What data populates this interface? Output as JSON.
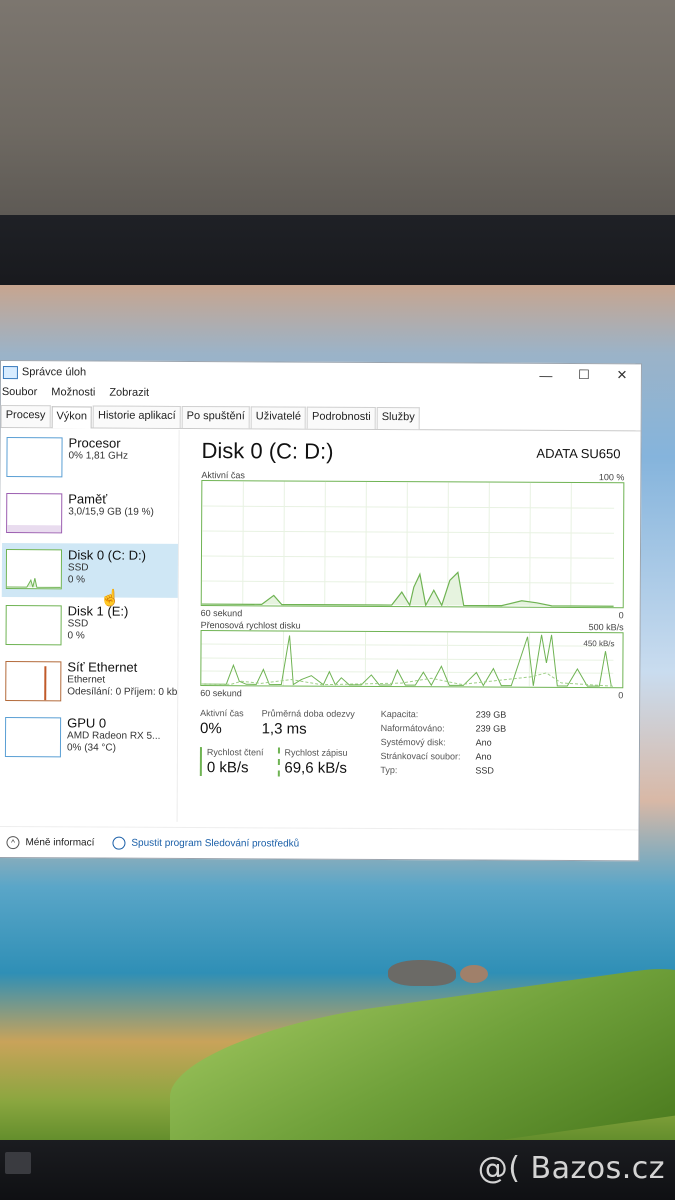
{
  "window": {
    "title": "Správce úloh",
    "minimize": "—",
    "maximize": "☐",
    "close": "✕"
  },
  "menu": [
    "Soubor",
    "Možnosti",
    "Zobrazit"
  ],
  "tabs": [
    "Procesy",
    "Výkon",
    "Historie aplikací",
    "Po spuštění",
    "Uživatelé",
    "Podrobnosti",
    "Služby"
  ],
  "active_tab": "Výkon",
  "resources": [
    {
      "name": "Procesor",
      "line1": "0% 1,81 GHz",
      "line2": "",
      "kind": "cpu"
    },
    {
      "name": "Paměť",
      "line1": "3,0/15,9 GB (19 %)",
      "line2": "",
      "kind": "mem"
    },
    {
      "name": "Disk 0 (C: D:)",
      "line1": "SSD",
      "line2": "0 %",
      "kind": "disk",
      "selected": true
    },
    {
      "name": "Disk 1 (E:)",
      "line1": "SSD",
      "line2": "0 %",
      "kind": "disk"
    },
    {
      "name": "Síť Ethernet",
      "line1": "Ethernet",
      "line2": "Odesílání: 0 Příjem: 0 kb",
      "kind": "net"
    },
    {
      "name": "GPU 0",
      "line1": "AMD Radeon RX 5...",
      "line2": "0% (34 °C)",
      "kind": "gpu"
    }
  ],
  "detail": {
    "title": "Disk 0 (C: D:)",
    "model": "ADATA SU650",
    "graph1": {
      "label_left": "Aktivní čas",
      "label_right": "100 %",
      "bottom_left": "60 sekund",
      "bottom_right": "0"
    },
    "graph2": {
      "label_left": "Přenosová rychlost disku",
      "label_right": "500 kB/s",
      "inner_label": "450 kB/s",
      "bottom_left": "60 sekund",
      "bottom_right": "0"
    },
    "stats": {
      "active_time_label": "Aktivní čas",
      "active_time_value": "0%",
      "response_label": "Průměrná doba odezvy",
      "response_value": "1,3 ms",
      "read_label": "Rychlost čtení",
      "read_value": "0 kB/s",
      "write_label": "Rychlost zápisu",
      "write_value": "69,6 kB/s"
    },
    "properties": [
      {
        "k": "Kapacita:",
        "v": "239 GB"
      },
      {
        "k": "Naformátováno:",
        "v": "239 GB"
      },
      {
        "k": "Systémový disk:",
        "v": "Ano"
      },
      {
        "k": "Stránkovací soubor:",
        "v": "Ano"
      },
      {
        "k": "Typ:",
        "v": "SSD"
      }
    ]
  },
  "footer": {
    "less_info": "Méně informací",
    "open_monitor": "Spustit program Sledování prostředků"
  },
  "watermark": "@( Bazos.cz"
}
